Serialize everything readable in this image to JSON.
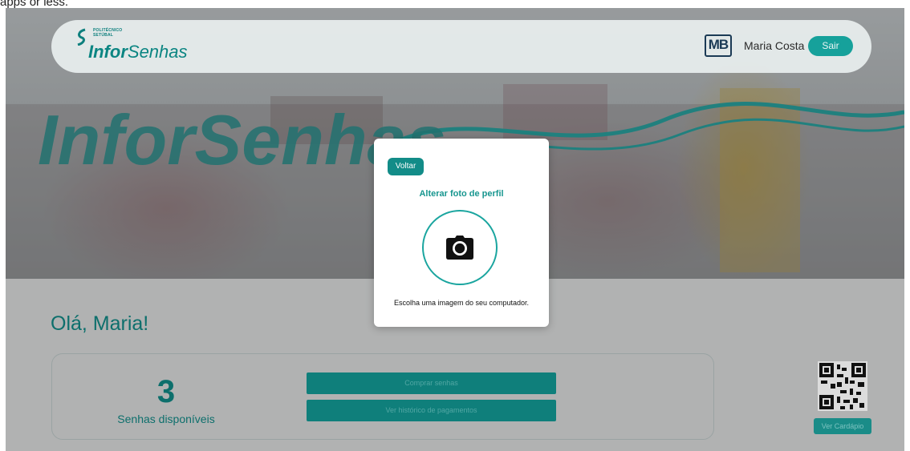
{
  "top_caption": "apps or less.",
  "header": {
    "logo_small_line1": "POLITÉCNICO",
    "logo_small_line2": "SETÚBAL",
    "logo_brand_bold": "Infor",
    "logo_brand_regular": "Senhas",
    "payment_logo": "MB",
    "user_name": "Maria Costa",
    "logout_label": "Sair"
  },
  "hero": {
    "watermark_text": "InforSenhas"
  },
  "main": {
    "greeting": "Olá, Maria!",
    "tickets_count": "3",
    "tickets_label": "Senhas disponíveis",
    "buy_button": "Comprar senhas",
    "history_button": "Ver histórico de pagamentos",
    "menu_button": "Ver Cardápio"
  },
  "modal": {
    "back_label": "Voltar",
    "title": "Alterar foto de perfil",
    "hint": "Escolha uma imagem do seu computador."
  },
  "icons": {
    "camera": "camera-icon",
    "qr": "qr-code-icon",
    "logo_swoosh": "logo-swoosh-icon"
  },
  "colors": {
    "brand_teal": "#16a19b",
    "brand_dark_teal": "#0d6f6c",
    "modal_bg": "#ffffff"
  }
}
